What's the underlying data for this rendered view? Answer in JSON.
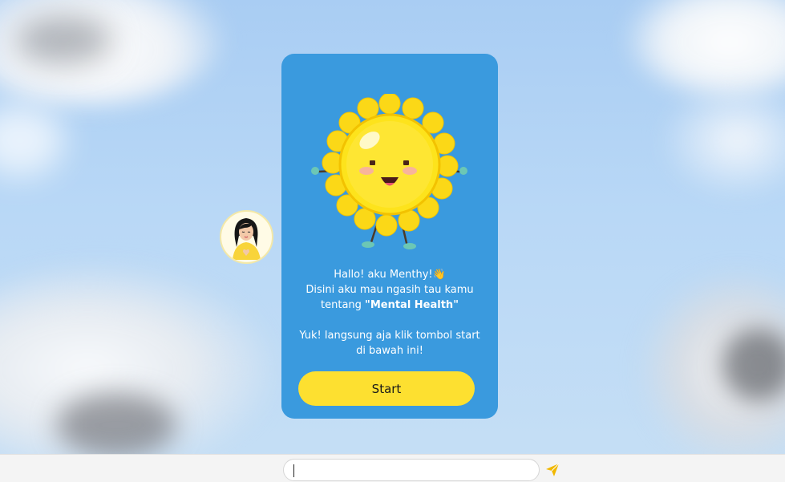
{
  "card": {
    "greeting": "Hallo! aku Menthy!👋",
    "line2": "Disini aku mau ngasih tau kamu",
    "line3_prefix": "tentang ",
    "topic": "\"Mental Health\"",
    "cta_line1": "Yuk! langsung aja klik tombol start",
    "cta_line2": "di bawah ini!",
    "start_label": "Start"
  },
  "chat": {
    "input_value": "",
    "input_placeholder": ""
  },
  "icons": {
    "mascot": "sun-mascot-icon",
    "avatar": "girl-heart-hands-avatar",
    "send": "paper-plane-icon"
  },
  "colors": {
    "card_bg": "#3a9ade",
    "button_bg": "#fde030",
    "send_icon": "#f1b800",
    "bottom_bar": "#f4f4f4"
  }
}
